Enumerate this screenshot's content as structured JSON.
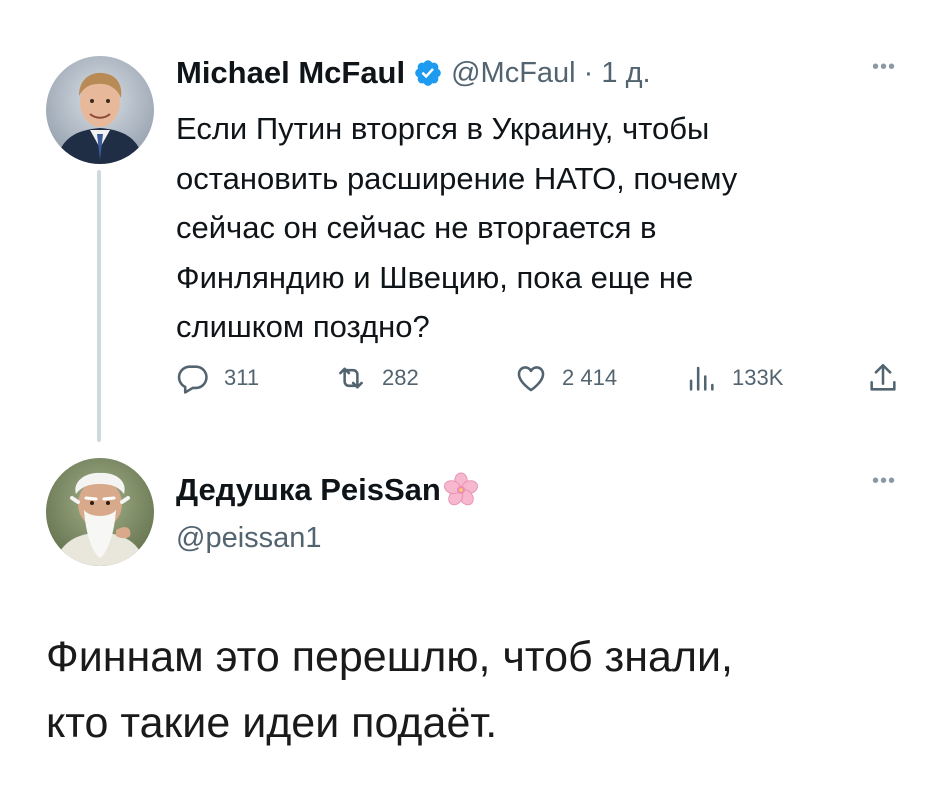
{
  "tweet1": {
    "display_name": "Michael McFaul",
    "handle_time": "@McFaul · 1 д.",
    "verified_icon": "verified-badge-icon",
    "more_label": "•••",
    "text_lines": [
      "Если Путин вторгся в Украину, чтобы",
      "остановить расширение НАТО, почему",
      "сейчас он сейчас не вторгается в",
      "Финляндию и Швецию, пока еще не",
      "слишком поздно?"
    ],
    "actions": {
      "replies": "311",
      "retweets": "282",
      "likes": "2 414",
      "views": "133K"
    }
  },
  "tweet2": {
    "display_name": "Дедушка PeisSan",
    "handle": "@peissan1",
    "more_label": "•••",
    "name_emoji": "cherry-blossom-icon"
  },
  "caption_lines": [
    "Финнам это перешлю, чтоб знали,",
    "кто такие идеи подаёт."
  ],
  "colors": {
    "verified": "#1d9bf0",
    "icon_gray": "#536471",
    "thread_line": "#cfd9de"
  }
}
